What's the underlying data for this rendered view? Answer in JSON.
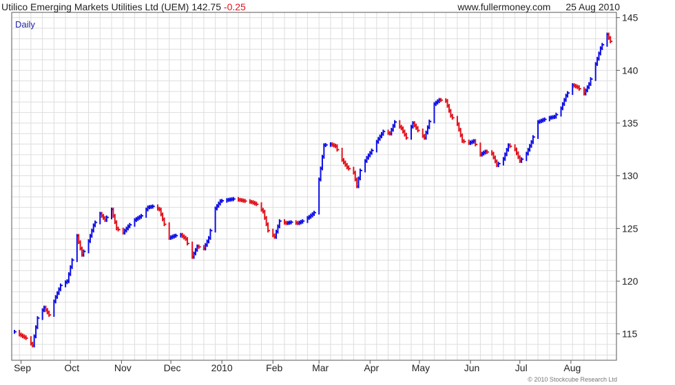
{
  "header": {
    "company": "Utilico Emerging Markets Utilities Ltd (UEM)",
    "price": "142.75",
    "change": "-0.25",
    "site": "www.fullermoney.com",
    "date": "25 Aug 2010"
  },
  "copyright": "© 2010 Stockcube Research Ltd",
  "colors": {
    "up": "#0b0be6",
    "down": "#e0101a",
    "grid": "#dddddd",
    "axis": "#555555",
    "period_label": "#2222aa"
  },
  "chart_data": {
    "type": "bar",
    "style": "OHLC daily price bars",
    "period_label": "Daily",
    "grid": true,
    "y_axis_side": "right",
    "ylim": [
      112.5,
      145.5
    ],
    "y_ticks": [
      115,
      120,
      125,
      130,
      135,
      140,
      145
    ],
    "x_range": [
      "2009-09-01",
      "2010-08-25"
    ],
    "x_ticks": [
      {
        "label": "Sep",
        "date": "2009-09-01"
      },
      {
        "label": "Oct",
        "date": "2009-10-01"
      },
      {
        "label": "Nov",
        "date": "2009-11-01"
      },
      {
        "label": "Dec",
        "date": "2009-12-01"
      },
      {
        "label": "2010",
        "date": "2010-01-01"
      },
      {
        "label": "Feb",
        "date": "2010-02-01"
      },
      {
        "label": "Mar",
        "date": "2010-03-01"
      },
      {
        "label": "Apr",
        "date": "2010-04-01"
      },
      {
        "label": "May",
        "date": "2010-05-01"
      },
      {
        "label": "Jun",
        "date": "2010-06-01"
      },
      {
        "label": "Jul",
        "date": "2010-07-01"
      },
      {
        "label": "Aug",
        "date": "2010-08-01"
      }
    ],
    "approx_closes": [
      [
        "2009-08-28",
        115.2
      ],
      [
        "2009-09-04",
        114.6
      ],
      [
        "2009-09-08",
        113.9
      ],
      [
        "2009-09-11",
        116.5
      ],
      [
        "2009-09-15",
        117.5
      ],
      [
        "2009-09-18",
        116.8
      ],
      [
        "2009-09-22",
        118.5
      ],
      [
        "2009-09-25",
        119.6
      ],
      [
        "2009-09-29",
        120.0
      ],
      [
        "2009-10-02",
        122.0
      ],
      [
        "2009-10-05",
        124.3
      ],
      [
        "2009-10-08",
        122.5
      ],
      [
        "2009-10-12",
        123.8
      ],
      [
        "2009-10-15",
        125.3
      ],
      [
        "2009-10-19",
        126.4
      ],
      [
        "2009-10-22",
        125.8
      ],
      [
        "2009-10-26",
        126.8
      ],
      [
        "2009-10-29",
        125.0
      ],
      [
        "2009-11-02",
        124.6
      ],
      [
        "2009-11-05",
        125.2
      ],
      [
        "2009-11-09",
        125.8
      ],
      [
        "2009-11-13",
        126.2
      ],
      [
        "2009-11-17",
        127.0
      ],
      [
        "2009-11-20",
        127.1
      ],
      [
        "2009-11-24",
        126.8
      ],
      [
        "2009-11-27",
        125.4
      ],
      [
        "2009-11-30",
        124.1
      ],
      [
        "2009-12-03",
        124.3
      ],
      [
        "2009-12-07",
        124.4
      ],
      [
        "2009-12-10",
        124.0
      ],
      [
        "2009-12-14",
        122.3
      ],
      [
        "2009-12-17",
        123.3
      ],
      [
        "2009-12-21",
        123.1
      ],
      [
        "2009-12-24",
        124.1
      ],
      [
        "2009-12-28",
        126.9
      ],
      [
        "2009-12-31",
        127.6
      ],
      [
        "2010-01-04",
        127.7
      ],
      [
        "2010-01-08",
        127.8
      ],
      [
        "2010-01-12",
        127.7
      ],
      [
        "2010-01-15",
        127.6
      ],
      [
        "2010-01-19",
        127.5
      ],
      [
        "2010-01-22",
        127.3
      ],
      [
        "2010-01-26",
        126.6
      ],
      [
        "2010-01-29",
        124.8
      ],
      [
        "2010-02-02",
        124.2
      ],
      [
        "2010-02-05",
        125.7
      ],
      [
        "2010-02-09",
        125.5
      ],
      [
        "2010-02-12",
        125.6
      ],
      [
        "2010-02-16",
        125.5
      ],
      [
        "2010-02-19",
        125.7
      ],
      [
        "2010-02-23",
        126.1
      ],
      [
        "2010-02-26",
        126.5
      ],
      [
        "2010-03-02",
        130.7
      ],
      [
        "2010-03-04",
        132.9
      ],
      [
        "2010-03-08",
        133.0
      ],
      [
        "2010-03-11",
        132.8
      ],
      [
        "2010-03-15",
        131.5
      ],
      [
        "2010-03-18",
        130.8
      ],
      [
        "2010-03-22",
        130.3
      ],
      [
        "2010-03-24",
        129.0
      ],
      [
        "2010-03-26",
        130.5
      ],
      [
        "2010-03-30",
        131.7
      ],
      [
        "2010-04-02",
        132.4
      ],
      [
        "2010-04-06",
        133.5
      ],
      [
        "2010-04-09",
        134.2
      ],
      [
        "2010-04-13",
        134.0
      ],
      [
        "2010-04-16",
        135.1
      ],
      [
        "2010-04-20",
        134.5
      ],
      [
        "2010-04-23",
        133.6
      ],
      [
        "2010-04-27",
        135.0
      ],
      [
        "2010-04-30",
        134.3
      ],
      [
        "2010-05-04",
        133.6
      ],
      [
        "2010-05-06",
        134.6
      ],
      [
        "2010-05-10",
        136.8
      ],
      [
        "2010-05-13",
        137.2
      ],
      [
        "2010-05-17",
        137.1
      ],
      [
        "2010-05-20",
        135.7
      ],
      [
        "2010-05-24",
        134.9
      ],
      [
        "2010-05-27",
        133.3
      ],
      [
        "2010-05-31",
        133.1
      ],
      [
        "2010-06-03",
        133.3
      ],
      [
        "2010-06-07",
        132.0
      ],
      [
        "2010-06-10",
        132.3
      ],
      [
        "2010-06-14",
        132.1
      ],
      [
        "2010-06-17",
        131.0
      ],
      [
        "2010-06-21",
        131.6
      ],
      [
        "2010-06-24",
        132.9
      ],
      [
        "2010-06-28",
        132.5
      ],
      [
        "2010-07-01",
        131.4
      ],
      [
        "2010-07-05",
        132.1
      ],
      [
        "2010-07-08",
        133.2
      ],
      [
        "2010-07-12",
        135.1
      ],
      [
        "2010-07-15",
        135.3
      ],
      [
        "2010-07-19",
        135.5
      ],
      [
        "2010-07-22",
        135.6
      ],
      [
        "2010-07-26",
        136.4
      ],
      [
        "2010-07-29",
        137.6
      ],
      [
        "2010-08-02",
        138.6
      ],
      [
        "2010-08-05",
        138.4
      ],
      [
        "2010-08-09",
        137.8
      ],
      [
        "2010-08-12",
        138.7
      ],
      [
        "2010-08-16",
        140.6
      ],
      [
        "2010-08-19",
        142.1
      ],
      [
        "2010-08-23",
        143.4
      ],
      [
        "2010-08-25",
        142.75
      ]
    ]
  }
}
